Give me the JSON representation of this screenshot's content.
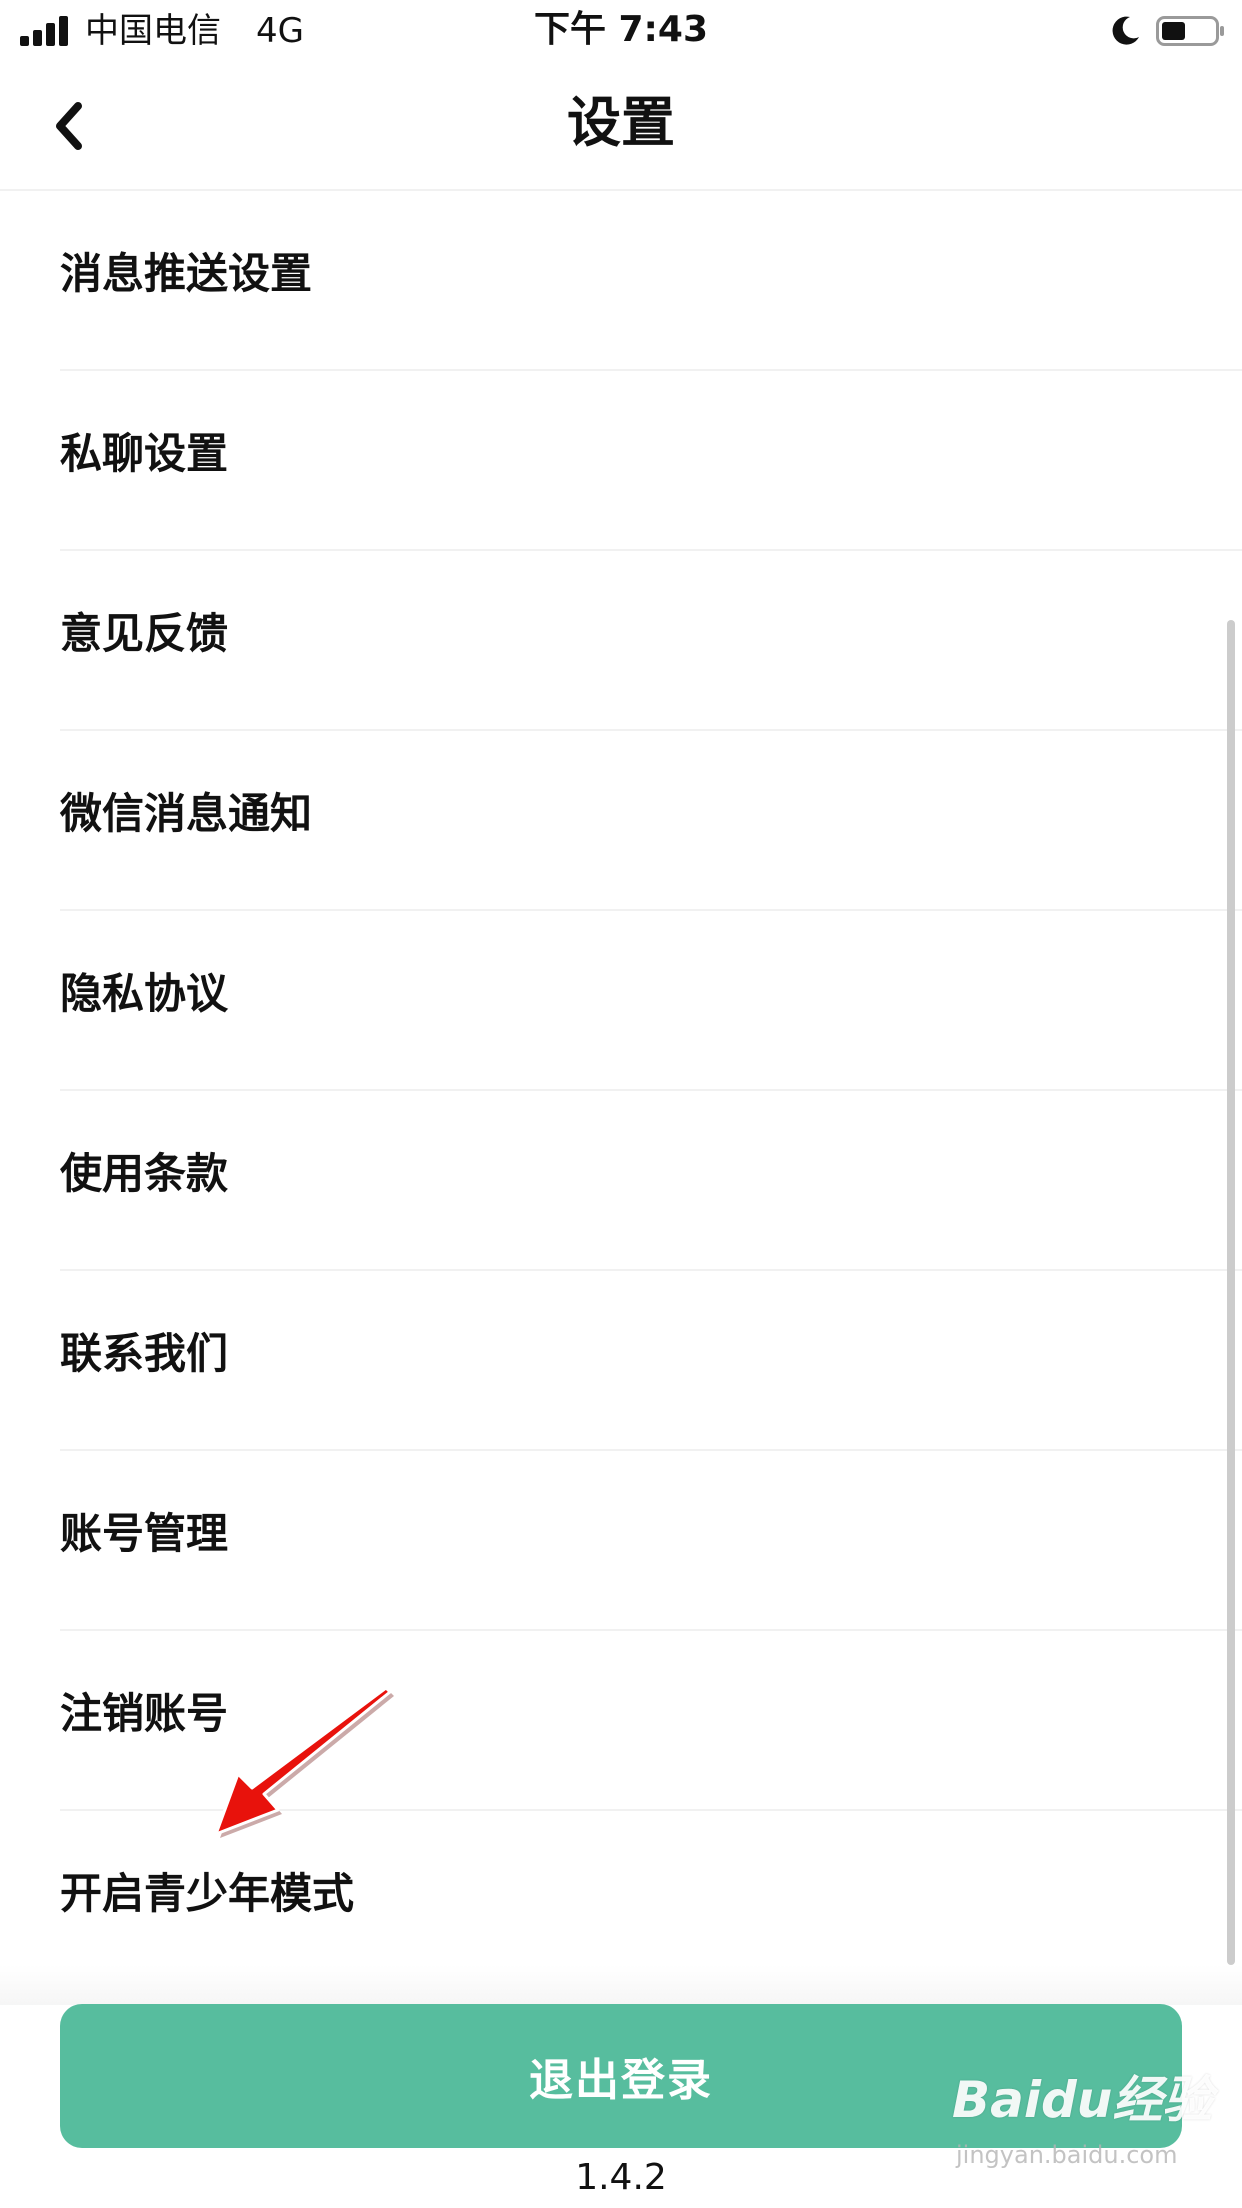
{
  "status_bar": {
    "carrier": "中国电信",
    "network": "4G",
    "time": "下午 7:43",
    "signal_bars": 4,
    "battery_level": 0.45,
    "icons": [
      "signal-icon",
      "moon-icon",
      "battery-icon"
    ]
  },
  "nav": {
    "title": "设置",
    "back_icon": "chevron-left-icon"
  },
  "settings": {
    "items": [
      {
        "label": "消息推送设置"
      },
      {
        "label": "私聊设置"
      },
      {
        "label": "意见反馈"
      },
      {
        "label": "微信消息通知"
      },
      {
        "label": "隐私协议"
      },
      {
        "label": "使用条款"
      },
      {
        "label": "联系我们"
      },
      {
        "label": "账号管理"
      },
      {
        "label": "注销账号"
      },
      {
        "label": "开启青少年模式"
      }
    ]
  },
  "logout": {
    "label": "退出登录"
  },
  "version": "1.4.2",
  "watermark": {
    "brand": "Baidu经验",
    "url": "jingyan.baidu.com"
  },
  "colors": {
    "accent": "#57BD9E",
    "annotation_arrow": "#E8120C",
    "text": "#111111",
    "divider": "#F1F1F1"
  }
}
